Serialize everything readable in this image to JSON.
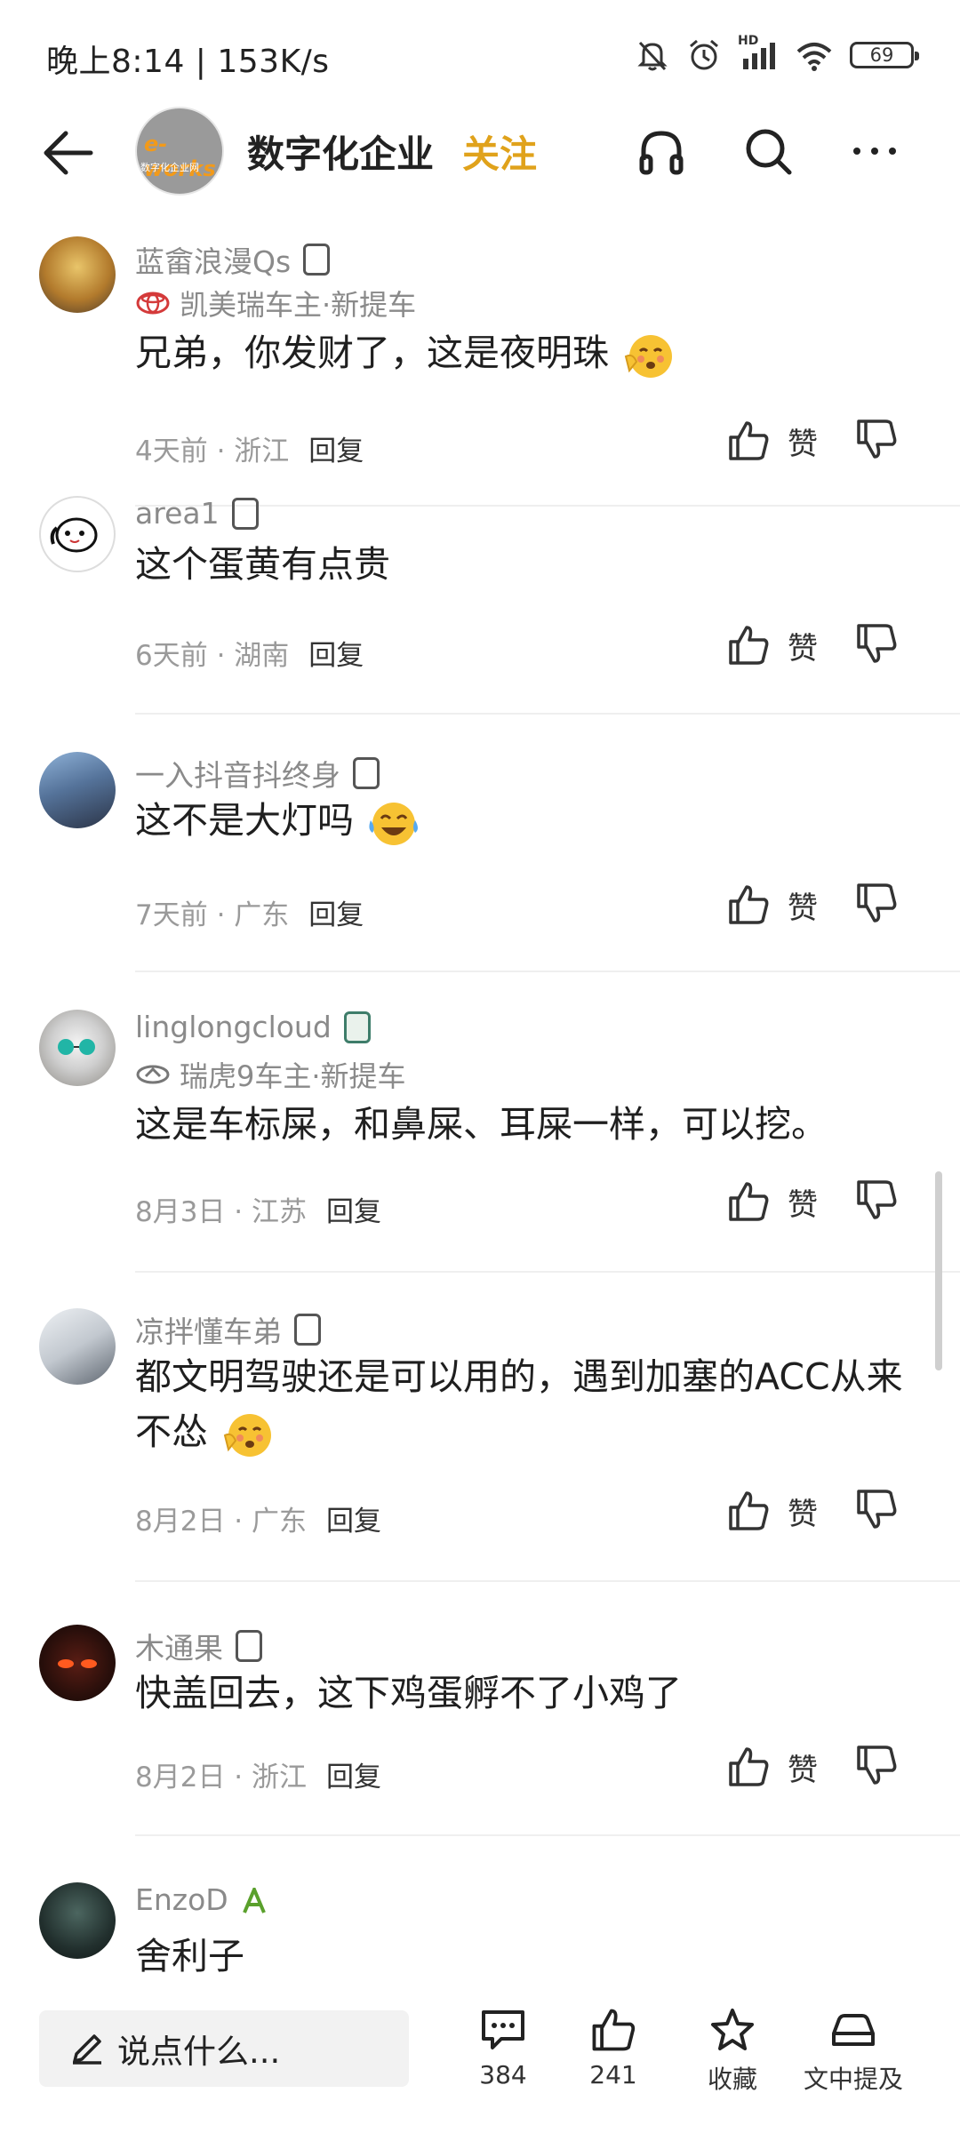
{
  "status_bar": {
    "time": "晚上8:14 | 153K/s",
    "battery": "69",
    "network_label": "HD"
  },
  "header": {
    "channel_logo_text": "e-works",
    "channel_logo_sub": "数字化企业网",
    "channel_name": "数字化企业",
    "follow_label": "关注"
  },
  "comments": [
    {
      "user": "蓝畲浪漫Qs",
      "car": "凯美瑞车主·新提车",
      "text": "兄弟，你发财了，这是夜明珠",
      "emoji": "blushing-face-emoji",
      "time": "4天前 · 浙江",
      "reply": "回复",
      "like": "赞"
    },
    {
      "user": "area1",
      "car": "",
      "text": "这个蛋黄有点贵",
      "time": "6天前 · 湖南",
      "reply": "回复",
      "like": "赞"
    },
    {
      "user": "一入抖音抖终身",
      "car": "",
      "text": "这不是大灯吗",
      "emoji": "laughing-tears-emoji",
      "time": "7天前 · 广东",
      "reply": "回复",
      "like": "赞"
    },
    {
      "user": "linglongcloud",
      "car": "瑞虎9车主·新提车",
      "text": "这是车标屎，和鼻屎、耳屎一样，可以挖。",
      "time": "8月3日 · 江苏",
      "reply": "回复",
      "like": "赞"
    },
    {
      "user": "凉拌懂车弟",
      "car": "",
      "text": "都文明驾驶还是可以用的，遇到加塞的ACC从来不怂",
      "emoji": "blushing-face-emoji",
      "time": "8月2日 · 广东",
      "reply": "回复",
      "like": "赞"
    },
    {
      "user": "木通果",
      "car": "",
      "text": "快盖回去，这下鸡蛋孵不了小鸡了",
      "time": "8月2日 · 浙江",
      "reply": "回复",
      "like": "赞"
    },
    {
      "user": "EnzoD",
      "car": "",
      "text": "舍利子",
      "time": "",
      "reply": "",
      "like": ""
    }
  ],
  "bottom_bar": {
    "input_placeholder": "说点什么...",
    "comment_count": "384",
    "like_count": "241",
    "favorite_label": "收藏",
    "mention_label": "文中提及"
  },
  "colors": {
    "accent_follow": "#e0a21b",
    "text_secondary": "#8a8a8a"
  }
}
